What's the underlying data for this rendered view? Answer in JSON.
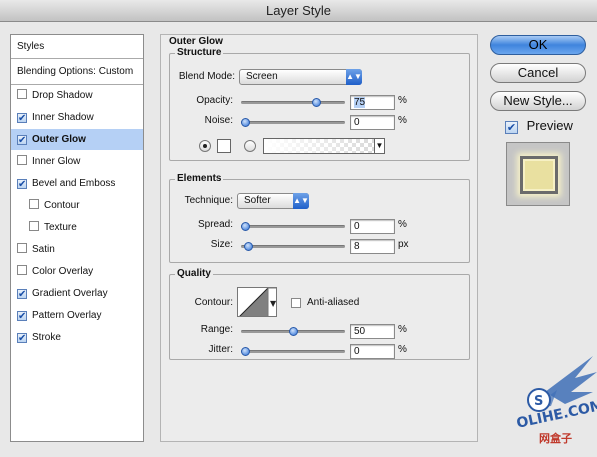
{
  "window": {
    "title": "Layer Style"
  },
  "styles_list": {
    "header": "Styles",
    "blending": "Blending Options: Custom",
    "items": [
      {
        "label": "Drop Shadow",
        "checked": false,
        "selected": false,
        "indent": false
      },
      {
        "label": "Inner Shadow",
        "checked": true,
        "selected": false,
        "indent": false
      },
      {
        "label": "Outer Glow",
        "checked": true,
        "selected": true,
        "indent": false
      },
      {
        "label": "Inner Glow",
        "checked": false,
        "selected": false,
        "indent": false
      },
      {
        "label": "Bevel and Emboss",
        "checked": true,
        "selected": false,
        "indent": false
      },
      {
        "label": "Contour",
        "checked": false,
        "selected": false,
        "indent": true
      },
      {
        "label": "Texture",
        "checked": false,
        "selected": false,
        "indent": true
      },
      {
        "label": "Satin",
        "checked": false,
        "selected": false,
        "indent": false
      },
      {
        "label": "Color Overlay",
        "checked": false,
        "selected": false,
        "indent": false
      },
      {
        "label": "Gradient Overlay",
        "checked": true,
        "selected": false,
        "indent": false
      },
      {
        "label": "Pattern Overlay",
        "checked": true,
        "selected": false,
        "indent": false
      },
      {
        "label": "Stroke",
        "checked": true,
        "selected": false,
        "indent": false
      }
    ]
  },
  "panel": {
    "title": "Outer Glow",
    "structure": {
      "label": "Structure",
      "blend_mode_label": "Blend Mode:",
      "blend_mode": "Screen",
      "opacity_label": "Opacity:",
      "opacity": "75",
      "opacity_fraction": 0.75,
      "noise_label": "Noise:",
      "noise": "0",
      "noise_fraction": 0,
      "unit": "%"
    },
    "elements": {
      "label": "Elements",
      "technique_label": "Technique:",
      "technique": "Softer",
      "spread_label": "Spread:",
      "spread": "0",
      "spread_fraction": 0,
      "spread_unit": "%",
      "size_label": "Size:",
      "size": "8",
      "size_fraction": 0.03,
      "size_unit": "px"
    },
    "quality": {
      "label": "Quality",
      "contour_label": "Contour:",
      "anti_aliased_label": "Anti-aliased",
      "range_label": "Range:",
      "range": "50",
      "range_fraction": 0.5,
      "range_unit": "%",
      "jitter_label": "Jitter:",
      "jitter": "0",
      "jitter_fraction": 0,
      "jitter_unit": "%"
    }
  },
  "buttons": {
    "ok": "OK",
    "cancel": "Cancel",
    "new_style": "New Style...",
    "preview_label": "Preview"
  },
  "watermark": {
    "text_line": "OLIHE.COM",
    "cn_text": "网盒子"
  }
}
